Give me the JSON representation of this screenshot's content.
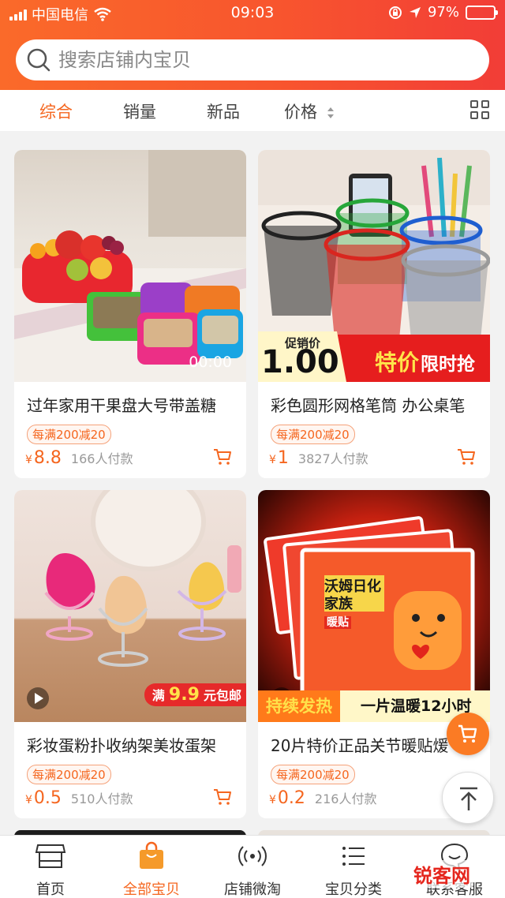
{
  "status_bar": {
    "carrier": "中国电信",
    "time": "09:03",
    "battery": "97%"
  },
  "search": {
    "placeholder": "搜索店铺内宝贝"
  },
  "sort_bar": {
    "items": [
      "综合",
      "销量",
      "新品",
      "价格"
    ],
    "active": "综合"
  },
  "products": [
    {
      "title": "过年家用干果盘大号带盖糖",
      "promo": "每满200减20",
      "currency": "¥",
      "price": "8.8",
      "sold": "166人付款",
      "video_duration": "00:00"
    },
    {
      "title": "彩色圆形网格笔筒 办公桌笔",
      "promo": "每满200减20",
      "currency": "¥",
      "price": "1",
      "sold": "3827人付款",
      "banner_tag": "促销价",
      "banner_price": "1.00",
      "banner_text1": "特价",
      "banner_text2": "限时抢"
    },
    {
      "title": "彩妆蛋粉扑收纳架美妆蛋架",
      "promo": "每满200减20",
      "currency": "¥",
      "price": "0.5",
      "sold": "510人付款",
      "badge_prefix": "满",
      "badge_value": "9.9",
      "badge_suffix": "元包邮"
    },
    {
      "title": "20片特价正品关节暖贴煖",
      "promo": "每满200减20",
      "currency": "¥",
      "price": "0.2",
      "sold": "216人付款",
      "pack_title": "沃姆日化家族",
      "pack_sub": "暖贴",
      "banner_left": "持续发热",
      "banner_right": "一片温暖12小时"
    }
  ],
  "tab_bar": {
    "items": [
      {
        "label": "首页",
        "icon": "storefront-icon"
      },
      {
        "label": "全部宝贝",
        "icon": "shopping-bag-icon"
      },
      {
        "label": "店铺微淘",
        "icon": "broadcast-icon"
      },
      {
        "label": "宝贝分类",
        "icon": "category-list-icon"
      },
      {
        "label": "联系客服",
        "icon": "chat-icon"
      }
    ],
    "active": "全部宝贝"
  },
  "watermark": "锐客网",
  "colors": {
    "accent": "#f5661f",
    "header_start": "#fa6a2a",
    "header_end": "#f23d37"
  }
}
